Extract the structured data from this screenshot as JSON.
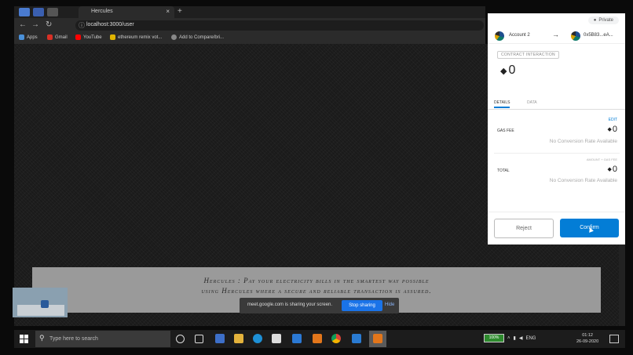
{
  "browser": {
    "tab_title": "Hercules",
    "tab_close": "×",
    "new_tab": "+",
    "url": "localhost:3000/user",
    "nav": {
      "back": "←",
      "forward": "→",
      "reload": "↻"
    },
    "bookmarks": [
      {
        "label": "Apps",
        "color": "#4a90d9"
      },
      {
        "label": "Gmail",
        "color": "#d93025"
      },
      {
        "label": "YouTube",
        "color": "#ff0000"
      },
      {
        "label": "ethereum remix vot...",
        "color": "#e0b400"
      },
      {
        "label": "Add to Compare/bri...",
        "color": "#888888"
      }
    ]
  },
  "page": {
    "footer_line1": "Hercules : Pay your electricity bills in the smartest way possible",
    "footer_line2": "using Hercules where a secure and reliable transaction is assured."
  },
  "screen_share": {
    "message": "meet.google.com is sharing your screen.",
    "stop_label": "Stop sharing",
    "hide_label": "Hide"
  },
  "metamask": {
    "network": "Private",
    "from_account": "Account 2",
    "to_account": "0x5B83...eA...",
    "contract_badge": "CONTRACT INTERACTION",
    "amount": "0",
    "tabs": [
      "DETAILS",
      "DATA"
    ],
    "edit_label": "EDIT",
    "gas_fee_label": "GAS FEE",
    "gas_fee_value": "0",
    "gas_conversion": "No Conversion Rate Available",
    "amount_gas_label": "AMOUNT + GAS FEE",
    "total_label": "TOTAL",
    "total_value": "0",
    "total_conversion": "No Conversion Rate Available",
    "reject_label": "Reject",
    "confirm_label": "Confirm",
    "accent_color": "#037dd6"
  },
  "taskbar": {
    "search_placeholder": "Type here to search",
    "battery": "100%",
    "language": "ENG",
    "time": "01:12",
    "date": "26-09-2020"
  }
}
